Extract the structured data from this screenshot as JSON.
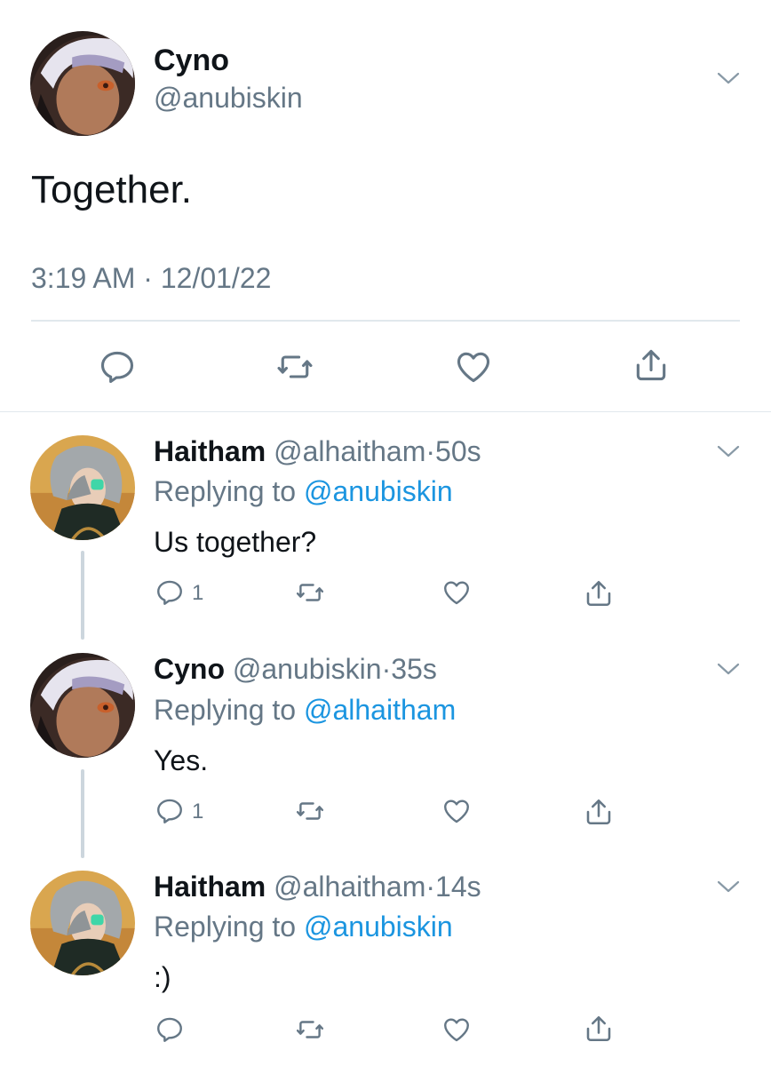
{
  "main_tweet": {
    "name": "Cyno",
    "handle": "@anubiskin",
    "text": "Together.",
    "time": "3:19 AM",
    "separator": "·",
    "date": "12/01/22"
  },
  "replies": [
    {
      "name": "Haitham",
      "handle": "@alhaitham",
      "separator": "·",
      "age": "50s",
      "replying_prefix": "Replying to",
      "replying_to": "@anubiskin",
      "text": "Us together?",
      "reply_count": "1"
    },
    {
      "name": "Cyno",
      "handle": "@anubiskin",
      "separator": "·",
      "age": "35s",
      "replying_prefix": "Replying to",
      "replying_to": "@alhaitham",
      "text": "Yes.",
      "reply_count": "1"
    },
    {
      "name": "Haitham",
      "handle": "@alhaitham",
      "separator": "·",
      "age": "14s",
      "replying_prefix": "Replying to",
      "replying_to": "@anubiskin",
      "text": ":)",
      "reply_count": ""
    }
  ],
  "icons": [
    "chevron-down-icon",
    "reply-icon",
    "retweet-icon",
    "like-icon",
    "share-icon"
  ],
  "colors": {
    "link": "#1b95e0",
    "muted": "#657786",
    "divider": "#e1e8ed",
    "thread_line": "#ccd6dd"
  }
}
